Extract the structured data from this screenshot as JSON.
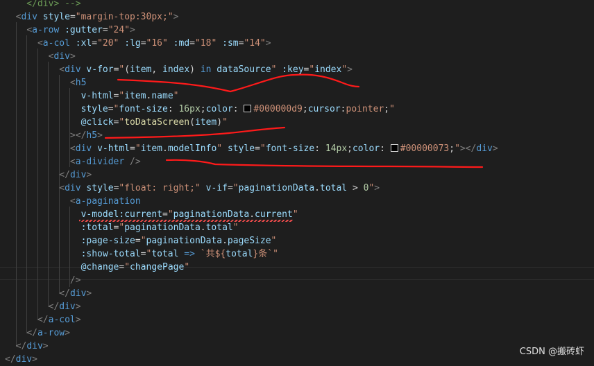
{
  "editor": {
    "lines": [
      [
        [
          "cmt",
          "    </div> -->"
        ]
      ],
      [
        [
          "op",
          "  "
        ],
        [
          "punc",
          "<"
        ],
        [
          "tag",
          "div"
        ],
        [
          "op",
          " "
        ],
        [
          "attr",
          "style"
        ],
        [
          "op",
          "="
        ],
        [
          "str",
          "\"margin-top:30px;\""
        ],
        [
          "punc",
          ">"
        ]
      ],
      [
        [
          "op",
          "    "
        ],
        [
          "punc",
          "<"
        ],
        [
          "tag",
          "a-row"
        ],
        [
          "op",
          " "
        ],
        [
          "attr",
          ":gutter"
        ],
        [
          "op",
          "="
        ],
        [
          "str",
          "\"24\""
        ],
        [
          "punc",
          ">"
        ]
      ],
      [
        [
          "op",
          "      "
        ],
        [
          "punc",
          "<"
        ],
        [
          "tag",
          "a-col"
        ],
        [
          "op",
          " "
        ],
        [
          "attr",
          ":xl"
        ],
        [
          "op",
          "="
        ],
        [
          "str",
          "\"20\""
        ],
        [
          "op",
          " "
        ],
        [
          "attr",
          ":lg"
        ],
        [
          "op",
          "="
        ],
        [
          "str",
          "\"16\""
        ],
        [
          "op",
          " "
        ],
        [
          "attr",
          ":md"
        ],
        [
          "op",
          "="
        ],
        [
          "str",
          "\"18\""
        ],
        [
          "op",
          " "
        ],
        [
          "attr",
          ":sm"
        ],
        [
          "op",
          "="
        ],
        [
          "str",
          "\"14\""
        ],
        [
          "punc",
          ">"
        ]
      ],
      [
        [
          "op",
          "        "
        ],
        [
          "punc",
          "<"
        ],
        [
          "tag",
          "div"
        ],
        [
          "punc",
          ">"
        ]
      ],
      [
        [
          "op",
          "          "
        ],
        [
          "punc",
          "<"
        ],
        [
          "tag",
          "div"
        ],
        [
          "op",
          " "
        ],
        [
          "attr",
          "v-for"
        ],
        [
          "op",
          "="
        ],
        [
          "str",
          "\""
        ],
        [
          "op",
          "("
        ],
        [
          "var",
          "item"
        ],
        [
          "op",
          ", "
        ],
        [
          "var",
          "index"
        ],
        [
          "op",
          ") "
        ],
        [
          "kw",
          "in"
        ],
        [
          "op",
          " "
        ],
        [
          "var",
          "dataSource"
        ],
        [
          "str",
          "\""
        ],
        [
          "op",
          " "
        ],
        [
          "attr",
          ":key"
        ],
        [
          "op",
          "="
        ],
        [
          "str",
          "\""
        ],
        [
          "var",
          "index"
        ],
        [
          "str",
          "\""
        ],
        [
          "punc",
          ">"
        ]
      ],
      [
        [
          "op",
          "            "
        ],
        [
          "punc",
          "<"
        ],
        [
          "tag",
          "h5"
        ]
      ],
      [
        [
          "op",
          "              "
        ],
        [
          "attr",
          "v-html"
        ],
        [
          "op",
          "="
        ],
        [
          "str",
          "\""
        ],
        [
          "var",
          "item"
        ],
        [
          "op",
          "."
        ],
        [
          "var",
          "name"
        ],
        [
          "str",
          "\""
        ]
      ],
      [
        [
          "op",
          "              "
        ],
        [
          "attr",
          "style"
        ],
        [
          "op",
          "="
        ],
        [
          "str",
          "\""
        ],
        [
          "attr",
          "font-size"
        ],
        [
          "op",
          ": "
        ],
        [
          "num",
          "16px"
        ],
        [
          "op",
          ";"
        ],
        [
          "attr",
          "color"
        ],
        [
          "op",
          ": "
        ],
        [
          "swatch",
          ""
        ],
        [
          "str",
          "#000000d9"
        ],
        [
          "op",
          ";"
        ],
        [
          "attr",
          "cursor"
        ],
        [
          "op",
          ":"
        ],
        [
          "str",
          "pointer"
        ],
        [
          "op",
          ";"
        ],
        [
          "str",
          "\""
        ]
      ],
      [
        [
          "op",
          "              "
        ],
        [
          "attr",
          "@click"
        ],
        [
          "op",
          "="
        ],
        [
          "str",
          "\""
        ],
        [
          "fn",
          "toDataScreen"
        ],
        [
          "op",
          "("
        ],
        [
          "var",
          "item"
        ],
        [
          "op",
          ")"
        ],
        [
          "str",
          "\""
        ]
      ],
      [
        [
          "op",
          "            "
        ],
        [
          "punc",
          "></"
        ],
        [
          "tag",
          "h5"
        ],
        [
          "punc",
          ">"
        ]
      ],
      [
        [
          "op",
          "            "
        ],
        [
          "punc",
          "<"
        ],
        [
          "tag",
          "div"
        ],
        [
          "op",
          " "
        ],
        [
          "attr",
          "v-html"
        ],
        [
          "op",
          "="
        ],
        [
          "str",
          "\""
        ],
        [
          "var",
          "item"
        ],
        [
          "op",
          "."
        ],
        [
          "var",
          "modelInfo"
        ],
        [
          "str",
          "\""
        ],
        [
          "op",
          " "
        ],
        [
          "attr",
          "style"
        ],
        [
          "op",
          "="
        ],
        [
          "str",
          "\""
        ],
        [
          "attr",
          "font-size"
        ],
        [
          "op",
          ": "
        ],
        [
          "num",
          "14px"
        ],
        [
          "op",
          ";"
        ],
        [
          "attr",
          "color"
        ],
        [
          "op",
          ": "
        ],
        [
          "swatch",
          ""
        ],
        [
          "str",
          "#00000073"
        ],
        [
          "op",
          ";"
        ],
        [
          "str",
          "\""
        ],
        [
          "punc",
          "></"
        ],
        [
          "tag",
          "div"
        ],
        [
          "punc",
          ">"
        ]
      ],
      [
        [
          "op",
          "            "
        ],
        [
          "punc",
          "<"
        ],
        [
          "tag",
          "a-divider"
        ],
        [
          "op",
          " "
        ],
        [
          "punc",
          "/>"
        ]
      ],
      [
        [
          "op",
          "          "
        ],
        [
          "punc",
          "</"
        ],
        [
          "tag",
          "div"
        ],
        [
          "punc",
          ">"
        ]
      ],
      [
        [
          "op",
          "          "
        ],
        [
          "punc",
          "<"
        ],
        [
          "tag",
          "div"
        ],
        [
          "op",
          " "
        ],
        [
          "attr",
          "style"
        ],
        [
          "op",
          "="
        ],
        [
          "str",
          "\"float: right;\""
        ],
        [
          "op",
          " "
        ],
        [
          "attr",
          "v-if"
        ],
        [
          "op",
          "="
        ],
        [
          "str",
          "\""
        ],
        [
          "var",
          "paginationData"
        ],
        [
          "op",
          "."
        ],
        [
          "var",
          "total"
        ],
        [
          "op",
          " > "
        ],
        [
          "num",
          "0"
        ],
        [
          "str",
          "\""
        ],
        [
          "punc",
          ">"
        ]
      ],
      [
        [
          "op",
          "            "
        ],
        [
          "punc",
          "<"
        ],
        [
          "tag",
          "a-pagination"
        ]
      ],
      [
        [
          "op",
          "              "
        ],
        [
          "attr",
          "v-model:current"
        ],
        [
          "op",
          "="
        ],
        [
          "str",
          "\""
        ],
        [
          "var",
          "paginationData"
        ],
        [
          "op",
          "."
        ],
        [
          "var",
          "current"
        ],
        [
          "str",
          "\""
        ]
      ],
      [
        [
          "op",
          "              "
        ],
        [
          "attr",
          ":total"
        ],
        [
          "op",
          "="
        ],
        [
          "str",
          "\""
        ],
        [
          "var",
          "paginationData"
        ],
        [
          "op",
          "."
        ],
        [
          "var",
          "total"
        ],
        [
          "str",
          "\""
        ]
      ],
      [
        [
          "op",
          "              "
        ],
        [
          "attr",
          ":page-size"
        ],
        [
          "op",
          "="
        ],
        [
          "str",
          "\""
        ],
        [
          "var",
          "paginationData"
        ],
        [
          "op",
          "."
        ],
        [
          "var",
          "pageSize"
        ],
        [
          "str",
          "\""
        ]
      ],
      [
        [
          "op",
          "              "
        ],
        [
          "attr",
          ":show-total"
        ],
        [
          "op",
          "="
        ],
        [
          "str",
          "\""
        ],
        [
          "var",
          "total"
        ],
        [
          "op",
          " "
        ],
        [
          "kw",
          "=>"
        ],
        [
          "op",
          " "
        ],
        [
          "str",
          "`共${"
        ],
        [
          "var",
          "total"
        ],
        [
          "str",
          "}条`"
        ],
        [
          "str",
          "\""
        ]
      ],
      [
        [
          "op",
          "              "
        ],
        [
          "attr",
          "@change"
        ],
        [
          "op",
          "="
        ],
        [
          "str",
          "\""
        ],
        [
          "var",
          "changePage"
        ],
        [
          "str",
          "\""
        ]
      ],
      [
        [
          "op",
          "            "
        ],
        [
          "punc",
          "/>"
        ]
      ],
      [
        [
          "op",
          "          "
        ],
        [
          "punc",
          "</"
        ],
        [
          "tag",
          "div"
        ],
        [
          "punc",
          ">"
        ]
      ],
      [
        [
          "op",
          "        "
        ],
        [
          "punc",
          "</"
        ],
        [
          "tag",
          "div"
        ],
        [
          "punc",
          ">"
        ]
      ],
      [
        [
          "op",
          "      "
        ],
        [
          "punc",
          "</"
        ],
        [
          "tag",
          "a-col"
        ],
        [
          "punc",
          ">"
        ]
      ],
      [
        [
          "op",
          "    "
        ],
        [
          "punc",
          "</"
        ],
        [
          "tag",
          "a-row"
        ],
        [
          "punc",
          ">"
        ]
      ],
      [
        [
          "op",
          "  "
        ],
        [
          "punc",
          "</"
        ],
        [
          "tag",
          "div"
        ],
        [
          "punc",
          ">"
        ]
      ],
      [
        [
          "punc",
          "</"
        ],
        [
          "tag",
          "div"
        ],
        [
          "punc",
          ">"
        ]
      ]
    ]
  },
  "colors": {
    "background": "#1e1e1e",
    "annotation_stroke": "#ff1a1a"
  },
  "watermark": "CSDN @搬砖虾"
}
